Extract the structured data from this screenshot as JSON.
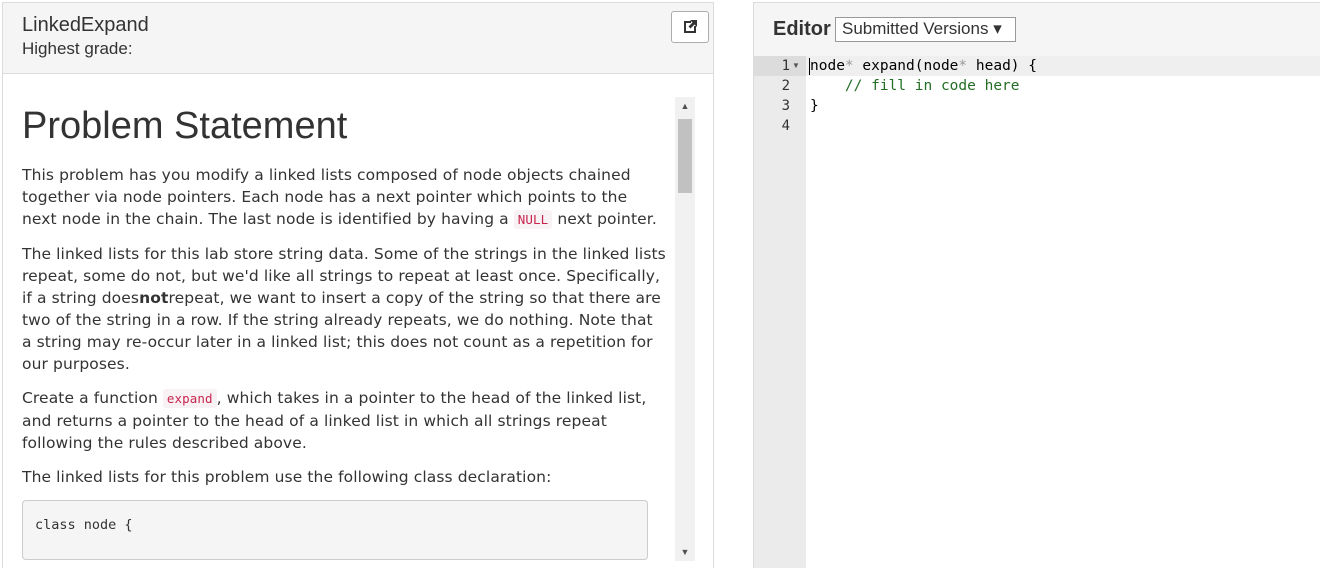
{
  "problem": {
    "title": "LinkedExpand",
    "grade_label": "Highest grade:"
  },
  "statement": {
    "heading": "Problem Statement",
    "p1_a": "This problem has you modify a linked lists composed of node objects chained together via node pointers. Each node has a next pointer which points to the next node in the chain. The last node is identified by having a ",
    "p1_code": "NULL",
    "p1_b": " next pointer.",
    "p2_a": "The linked lists for this lab store string data. Some of the strings in the linked lists repeat, some do not, but we'd like all strings to repeat at least once. Specifically, if a string does",
    "p2_bold": "not",
    "p2_b": "repeat, we want to insert a copy of the string so that there are two of the string in a row. If the string already repeats, we do nothing. Note that a string may re-occur later in a linked list; this does not count as a repetition for our purposes.",
    "p3_a": "Create a function ",
    "p3_code": "expand",
    "p3_b": ", which takes in a pointer to the head of the linked list, and returns a pointer to the head of a linked list in which all strings repeat following the rules described above.",
    "p4": "The linked lists for this problem use the following class declaration:",
    "code_block": "class node {"
  },
  "editor": {
    "label": "Editor",
    "versions_label": "Submitted Versions ▾",
    "line_numbers": [
      "1",
      "2",
      "3",
      "4"
    ],
    "line1": {
      "t1": "node",
      "t2": "*",
      "t3": " expand(node",
      "t4": "*",
      "t5": " head) {"
    },
    "line2_indent": "    ",
    "line2_comment": "// fill in code here",
    "line3": "}"
  },
  "icons": {
    "popout": "external-link-icon",
    "fold": "fold-arrow-icon",
    "scroll_up": "scroll-up-arrow",
    "scroll_down": "scroll-down-arrow"
  }
}
